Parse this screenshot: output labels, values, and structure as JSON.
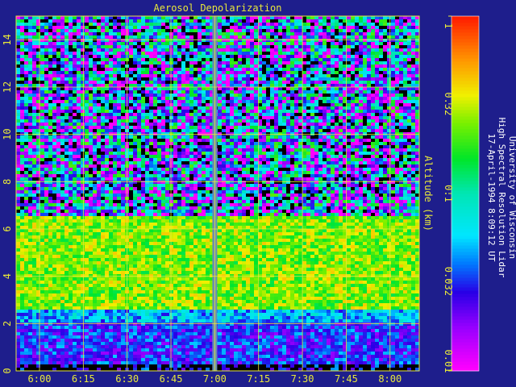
{
  "chart_data": {
    "type": "heatmap",
    "title": "Aerosol Depolarization",
    "ylabel": "Altitude (km)",
    "xlabel": "",
    "x_ticks": [
      "6:00",
      "6:15",
      "6:30",
      "6:45",
      "7:00",
      "7:15",
      "7:30",
      "7:45",
      "8:00"
    ],
    "y_ticks": [
      0,
      2,
      4,
      6,
      8,
      10,
      12,
      14
    ],
    "ylim": [
      0,
      15
    ],
    "xlim": [
      "5:52",
      "8:10"
    ],
    "grid": true,
    "grid_color": "#e8e83a",
    "colorbar": {
      "scale": "log",
      "ticks": [
        "0.01",
        "0.032",
        "0.1",
        "0.32",
        "1"
      ],
      "range": [
        0.01,
        1
      ]
    },
    "layers": [
      {
        "alt_range_km": [
          0,
          0.3
        ],
        "level": "no data"
      },
      {
        "alt_range_km": [
          0.3,
          2.0
        ],
        "depolarization_approx": 0.03
      },
      {
        "alt_range_km": [
          2.0,
          2.6
        ],
        "depolarization_approx": 0.05
      },
      {
        "alt_range_km": [
          2.6,
          6.5
        ],
        "depolarization_approx": 0.25
      },
      {
        "alt_range_km": [
          6.5,
          15
        ],
        "depolarization_approx": 0.04,
        "noise": "high"
      }
    ],
    "data_gap_time": "7:00"
  },
  "annotation": {
    "line1": "University of Wisconsin",
    "line2": "High Spectral Resolution Lidar",
    "line3": "17-April-1994  8:09:12 UT"
  },
  "colors": {
    "background": "#1e1e8c",
    "axis": "#e8e83a",
    "text": "#e8e83a",
    "annotation_text": "#ffffff"
  }
}
